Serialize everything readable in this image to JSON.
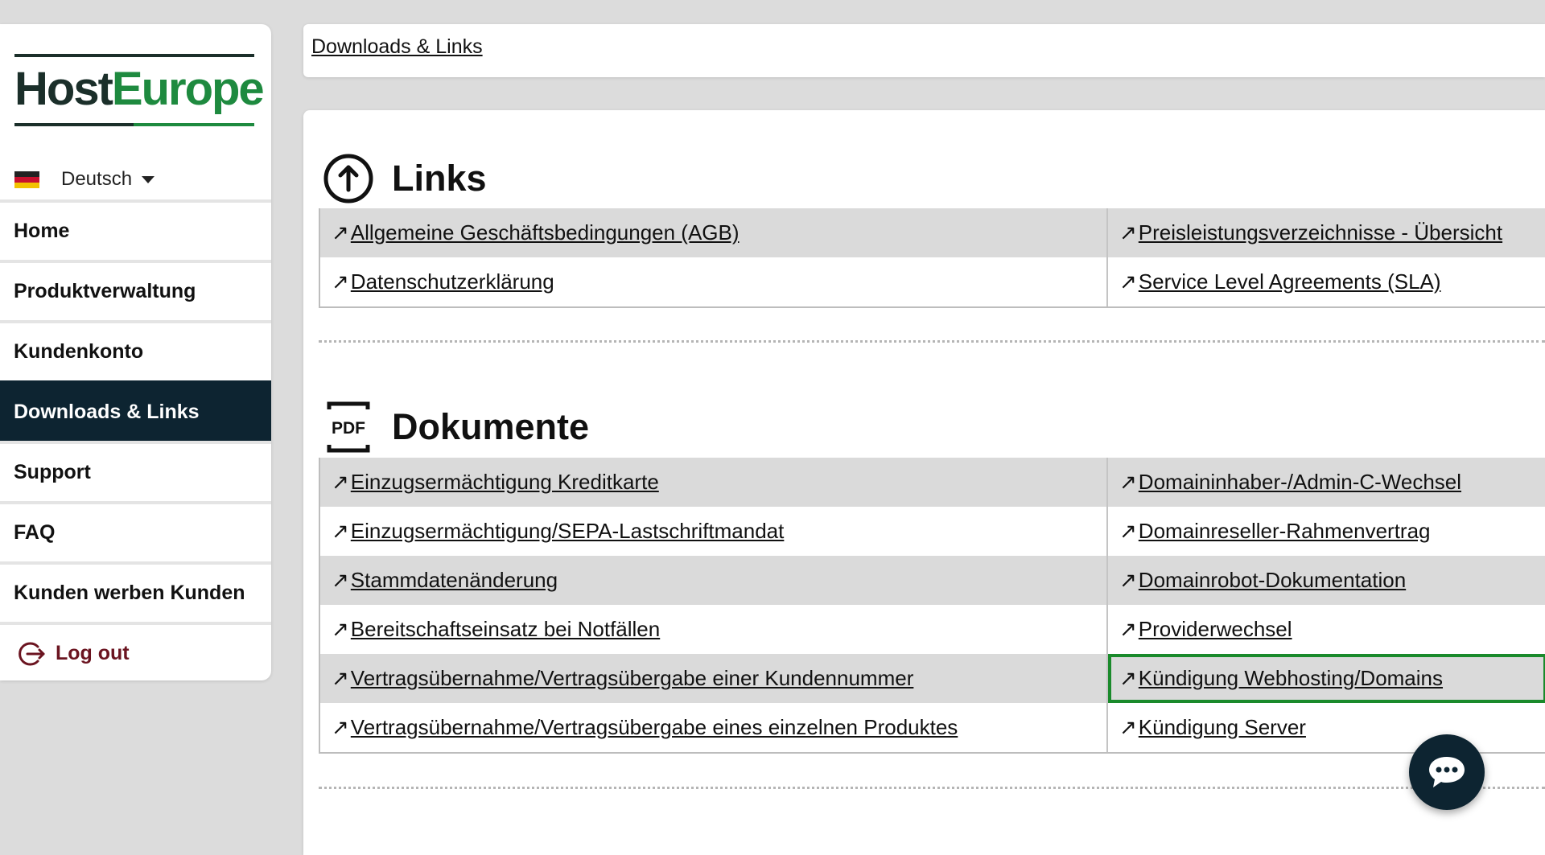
{
  "logo": {
    "part1": "Host",
    "part2": "Europe"
  },
  "colors": {
    "nav_active": "#0d2431",
    "brand_green": "#1e8a3f",
    "logout": "#6b1420",
    "highlight": "#1a8a2b"
  },
  "language": {
    "label": "Deutsch",
    "flag": "de-flag-icon"
  },
  "sidebar": {
    "items": [
      {
        "label": "Home",
        "active": false
      },
      {
        "label": "Produktverwaltung",
        "active": false
      },
      {
        "label": "Kundenkonto",
        "active": false
      },
      {
        "label": "Downloads & Links",
        "active": true
      },
      {
        "label": "Support",
        "active": false
      },
      {
        "label": "FAQ",
        "active": false
      },
      {
        "label": "Kunden werben Kunden",
        "active": false
      }
    ],
    "logout": "Log out"
  },
  "breadcrumb": "Downloads & Links",
  "links_section": {
    "title": "Links",
    "icon": "arrow-up-circle-icon",
    "rows": [
      {
        "left": "Allgemeine Geschäftsbedingungen (AGB)",
        "right": "Preisleistungsverzeichnisse - Übersicht"
      },
      {
        "left": "Datenschutzerklärung",
        "right": "Service Level Agreements (SLA)"
      }
    ]
  },
  "documents_section": {
    "title": "Dokumente",
    "icon": "pdf-icon",
    "icon_text": "PDF",
    "rows": [
      {
        "left": "Einzugsermächtigung Kreditkarte",
        "right": "Domaininhaber-/Admin-C-Wechsel"
      },
      {
        "left": "Einzugsermächtigung/SEPA-Lastschriftmandat",
        "right": "Domainreseller-Rahmenvertrag"
      },
      {
        "left": "Stammdatenänderung",
        "right": "Domainrobot-Dokumentation"
      },
      {
        "left": "Bereitschaftseinsatz bei Notfällen",
        "right": "Providerwechsel"
      },
      {
        "left": "Vertragsübernahme/Vertragsübergabe einer Kundennummer",
        "right": "Kündigung Webhosting/Domains"
      },
      {
        "left": "Vertragsübernahme/Vertragsübergabe eines einzelnen Produktes",
        "right": "Kündigung Server"
      }
    ]
  },
  "link_arrow": "↗",
  "chat": {
    "icon": "chat-bubble-icon"
  }
}
